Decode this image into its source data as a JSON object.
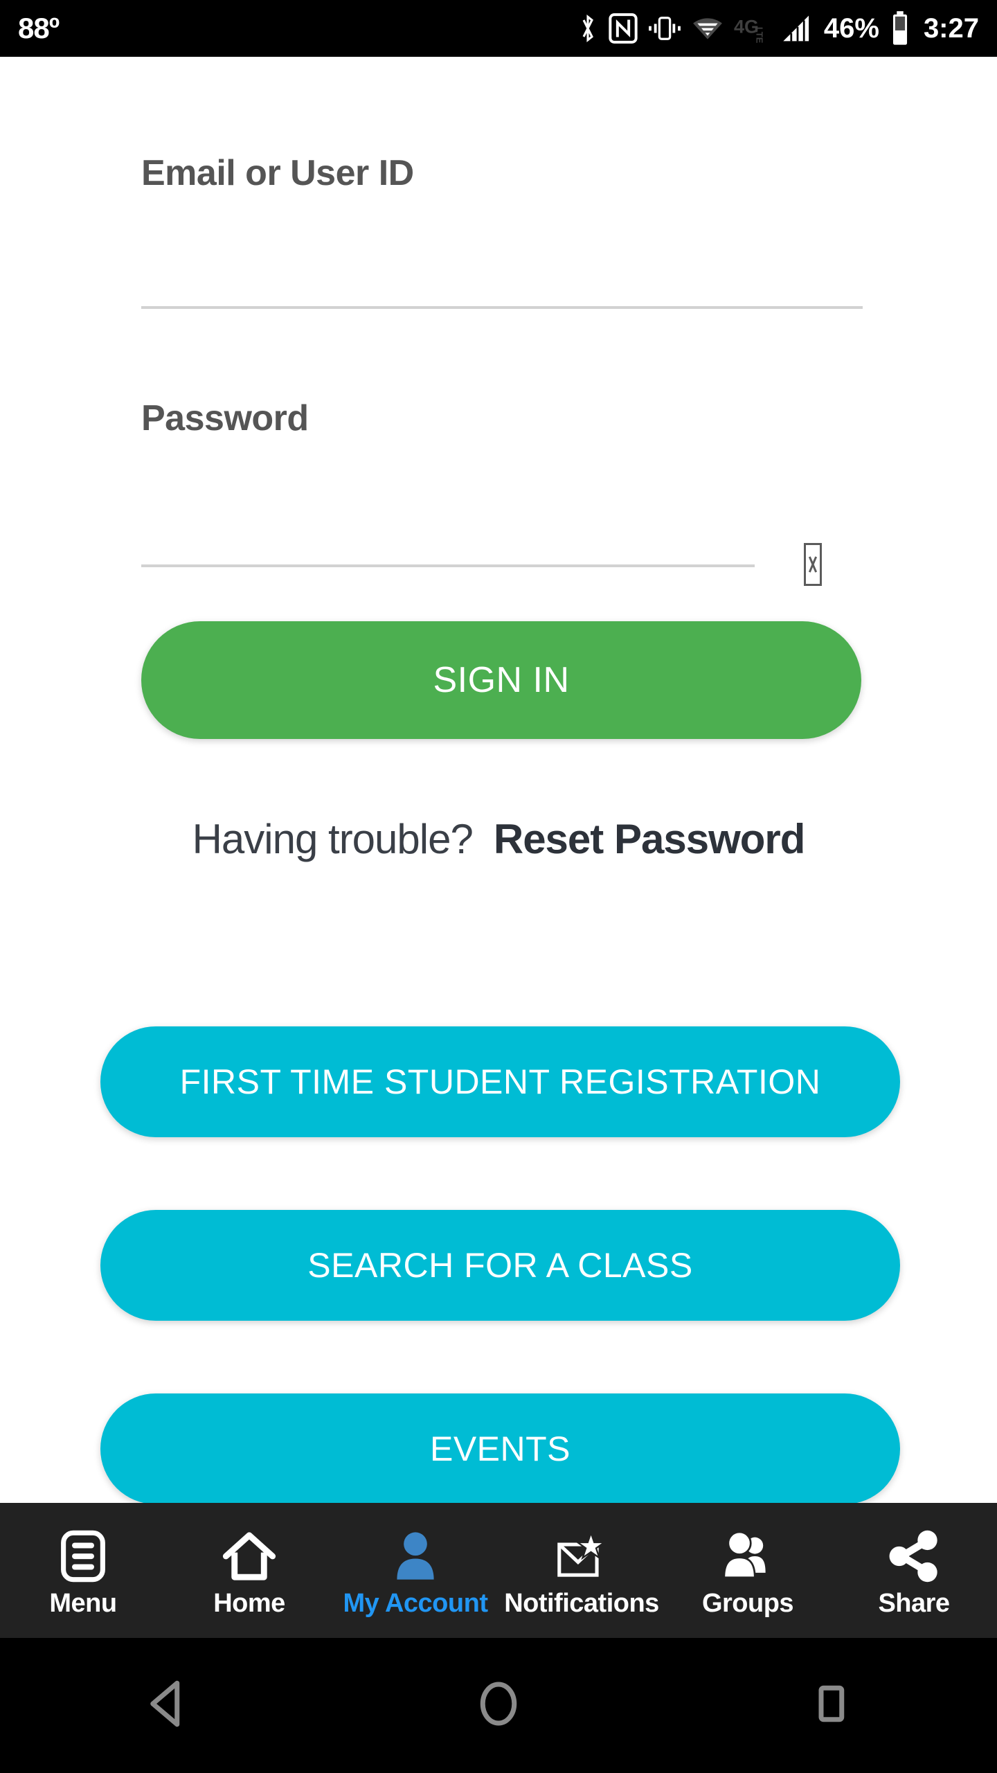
{
  "status_bar": {
    "temperature": "88º",
    "battery_percent": "46%",
    "network": "4G LTE",
    "time": "3:27",
    "icons": [
      "bluetooth-icon",
      "nfc-icon",
      "vibrate-icon",
      "wifi-icon",
      "network-4glte-icon",
      "signal-bars-icon",
      "battery-icon"
    ]
  },
  "form": {
    "email": {
      "label": "Email or User ID",
      "value": "",
      "placeholder": ""
    },
    "password": {
      "label": "Password",
      "value": "",
      "placeholder": "",
      "toggle_icon": "missing-glyph-tofu-icon"
    },
    "signin_button": "SIGN IN"
  },
  "help": {
    "question": "Having trouble?",
    "reset_link": "Reset Password"
  },
  "actions": [
    {
      "label": "FIRST TIME STUDENT REGISTRATION",
      "name": "first-time-student-registration-button"
    },
    {
      "label": "SEARCH FOR A CLASS",
      "name": "search-for-a-class-button"
    },
    {
      "label": "EVENTS",
      "name": "events-button"
    }
  ],
  "bottom_nav": {
    "items": [
      {
        "label": "Menu",
        "icon": "menu-list-icon",
        "active": false
      },
      {
        "label": "Home",
        "icon": "home-icon",
        "active": false
      },
      {
        "label": "My Account",
        "icon": "person-icon",
        "active": true
      },
      {
        "label": "Notifications",
        "icon": "envelope-star-icon",
        "active": false
      },
      {
        "label": "Groups",
        "icon": "people-group-icon",
        "active": false
      },
      {
        "label": "Share",
        "icon": "share-nodes-icon",
        "active": false
      }
    ]
  },
  "system_bar": {
    "back": "back-triangle-icon",
    "home": "home-circle-icon",
    "recents": "recents-square-icon"
  },
  "colors": {
    "primary_green": "#4CAF50",
    "accent_cyan": "#00BCD4",
    "active_blue": "#2196F3",
    "nav_background": "#222222",
    "status_background": "#000000"
  }
}
